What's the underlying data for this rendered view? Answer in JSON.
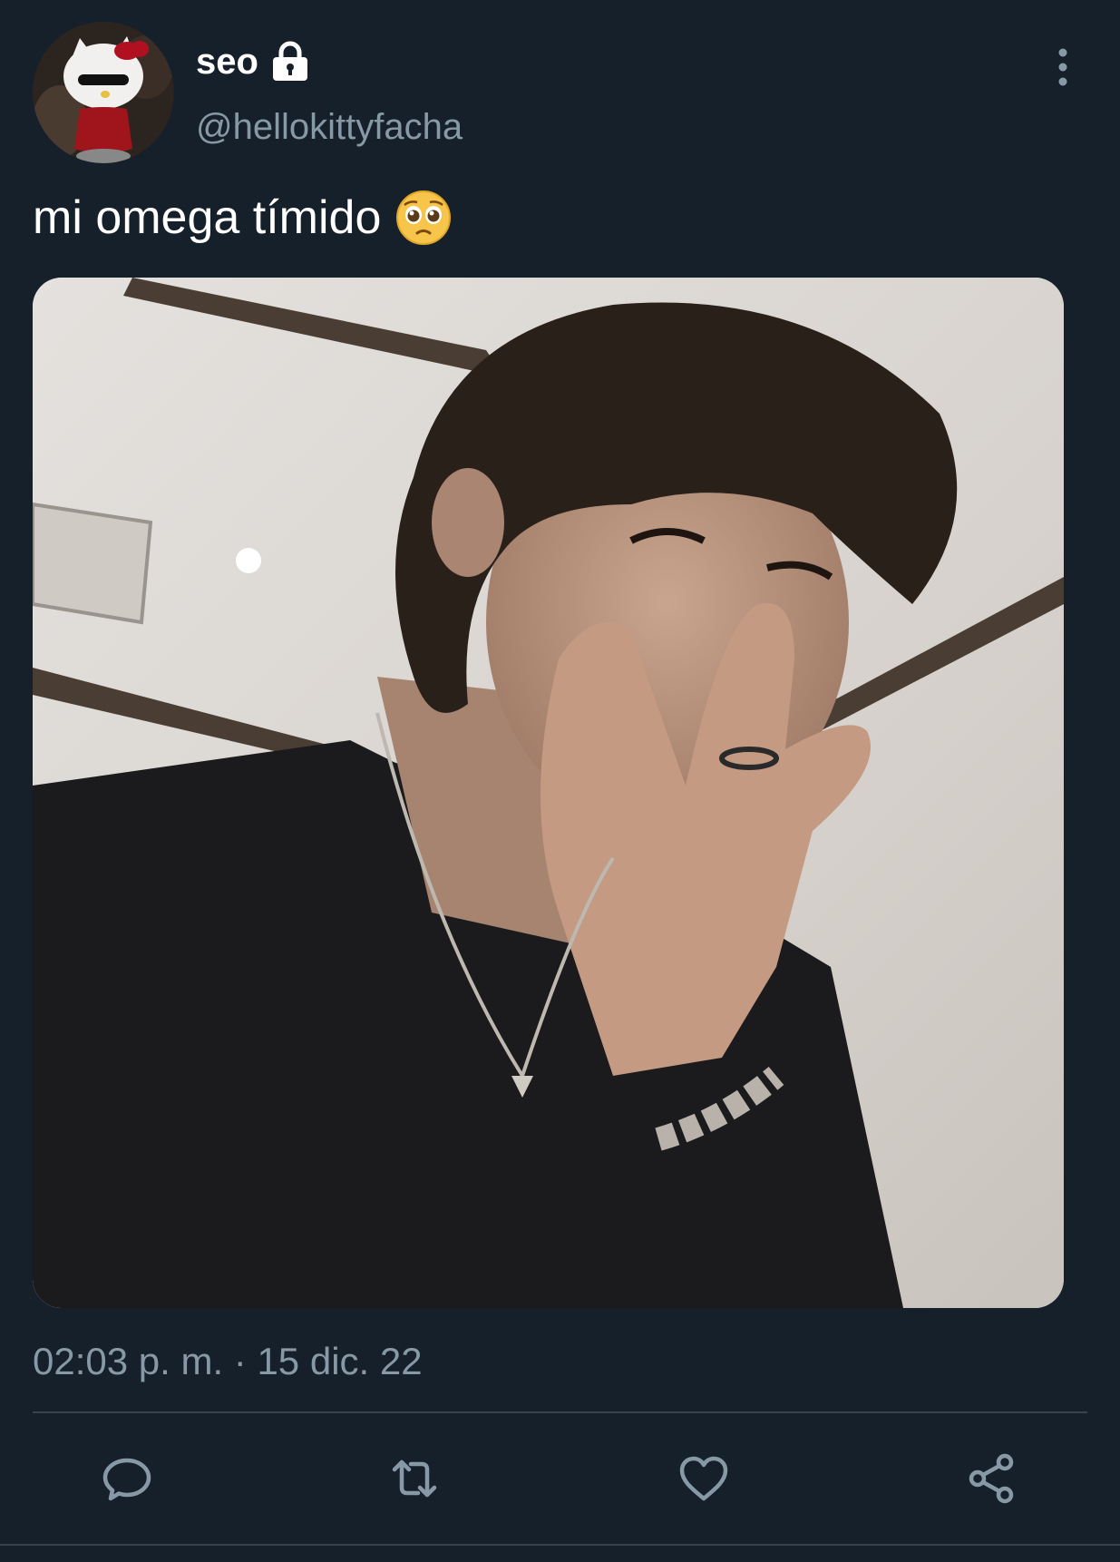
{
  "tweet": {
    "display_name": "seo",
    "handle": "@hellokittyfacha",
    "text": "mi omega tímido",
    "timestamp": "02:03 p. m. · 15 dic. 22",
    "protected_icon": "lock-icon",
    "emoji": "pleading-face-emoji"
  },
  "actions": [
    {
      "icon": "reply-icon"
    },
    {
      "icon": "retweet-icon"
    },
    {
      "icon": "like-icon"
    },
    {
      "icon": "share-icon"
    }
  ],
  "colors": {
    "background": "#15202b",
    "text": "#ffffff",
    "secondary_text": "#8899a6",
    "divider": "#38444d"
  }
}
